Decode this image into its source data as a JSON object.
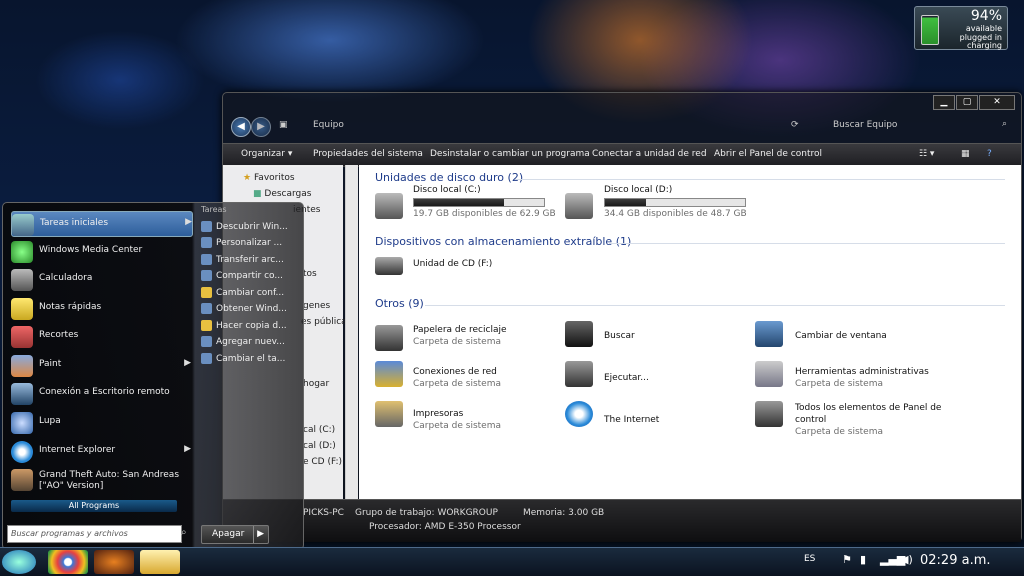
{
  "battery": {
    "percent": "94%",
    "line1": "available",
    "line2": "plugged in",
    "line3": "charging",
    "level": 0.94
  },
  "window": {
    "title_buttons": {
      "minimize": "▁",
      "maximize": "▢",
      "close": "✕"
    },
    "address": "Equipo",
    "search_placeholder": "Buscar Equipo",
    "toolbar": [
      "Organizar ▾",
      "Propiedades del sistema",
      "Desinstalar o cambiar un programa",
      "Conectar a unidad de red",
      "Abrir el Panel de control"
    ],
    "nav": {
      "favoritos": "Favoritos",
      "descargas": "Descargas",
      "frag1": "ientes",
      "frag2": "tos",
      "frag3": "genes",
      "frag4": "es públicas",
      "frag5": "hogar",
      "frag6": "cal (C:)",
      "frag7": "cal (D:)",
      "frag8": "e CD (F:)"
    },
    "sections": {
      "disks": {
        "header": "Unidades de disco duro (2)",
        "items": [
          {
            "name": "Disco local (C:)",
            "free": "19.7 GB disponibles de 62.9 GB",
            "used_fraction": 0.69
          },
          {
            "name": "Disco local (D:)",
            "free": "34.4 GB disponibles de 48.7 GB",
            "used_fraction": 0.29
          }
        ]
      },
      "removable": {
        "header": "Dispositivos con almacenamiento extraíble (1)",
        "items": [
          {
            "name": "Unidad de CD (F:)"
          }
        ]
      },
      "others": {
        "header": "Otros (9)",
        "items": [
          {
            "name": "Papelera de reciclaje",
            "sub": "Carpeta de sistema"
          },
          {
            "name": "Buscar",
            "sub": ""
          },
          {
            "name": "Cambiar de ventana",
            "sub": ""
          },
          {
            "name": "Conexiones de red",
            "sub": "Carpeta de sistema"
          },
          {
            "name": "Ejecutar...",
            "sub": ""
          },
          {
            "name": "Herramientas administrativas",
            "sub": "Carpeta de sistema"
          },
          {
            "name": "Impresoras",
            "sub": "Carpeta de sistema"
          },
          {
            "name": "The Internet",
            "sub": ""
          },
          {
            "name": "Todos los elementos de Panel de",
            "name2": "control",
            "sub": "Carpeta de sistema"
          }
        ]
      }
    },
    "details": {
      "pc": "PICKS-PC",
      "workgroup": "Grupo de trabajo:  WORKGROUP",
      "memory": "Memoria: 3.00 GB",
      "processor": "Procesador: AMD E-350 Processor"
    }
  },
  "start_menu": {
    "items": [
      {
        "label": "Tareas iniciales",
        "arrow": "▶"
      },
      {
        "label": "Windows Media Center"
      },
      {
        "label": "Calculadora"
      },
      {
        "label": "Notas rápidas"
      },
      {
        "label": "Recortes"
      },
      {
        "label": "Paint",
        "arrow": "▶"
      },
      {
        "label": "Conexión a Escritorio remoto"
      },
      {
        "label": "Lupa"
      },
      {
        "label": "Internet Explorer",
        "arrow": "▶"
      },
      {
        "label": "Grand Theft Auto: San Andreas",
        "label2": "[\"AO\" Version]"
      }
    ],
    "jump_header": "Tareas",
    "jump_list": [
      "Descubrir Win...",
      "Personalizar ...",
      "Transferir arc...",
      "Compartir co...",
      "Cambiar conf...",
      "Obtener Wind...",
      "Hacer copia d...",
      "Agregar nuev...",
      "Cambiar el ta..."
    ],
    "all_programs": "All Programs",
    "search_placeholder": "Buscar programas y archivos",
    "shutdown": "Apagar",
    "shutdown_arrow": "▶"
  },
  "taskbar": {
    "lang": "ES",
    "clock": "02:29 a.m."
  }
}
